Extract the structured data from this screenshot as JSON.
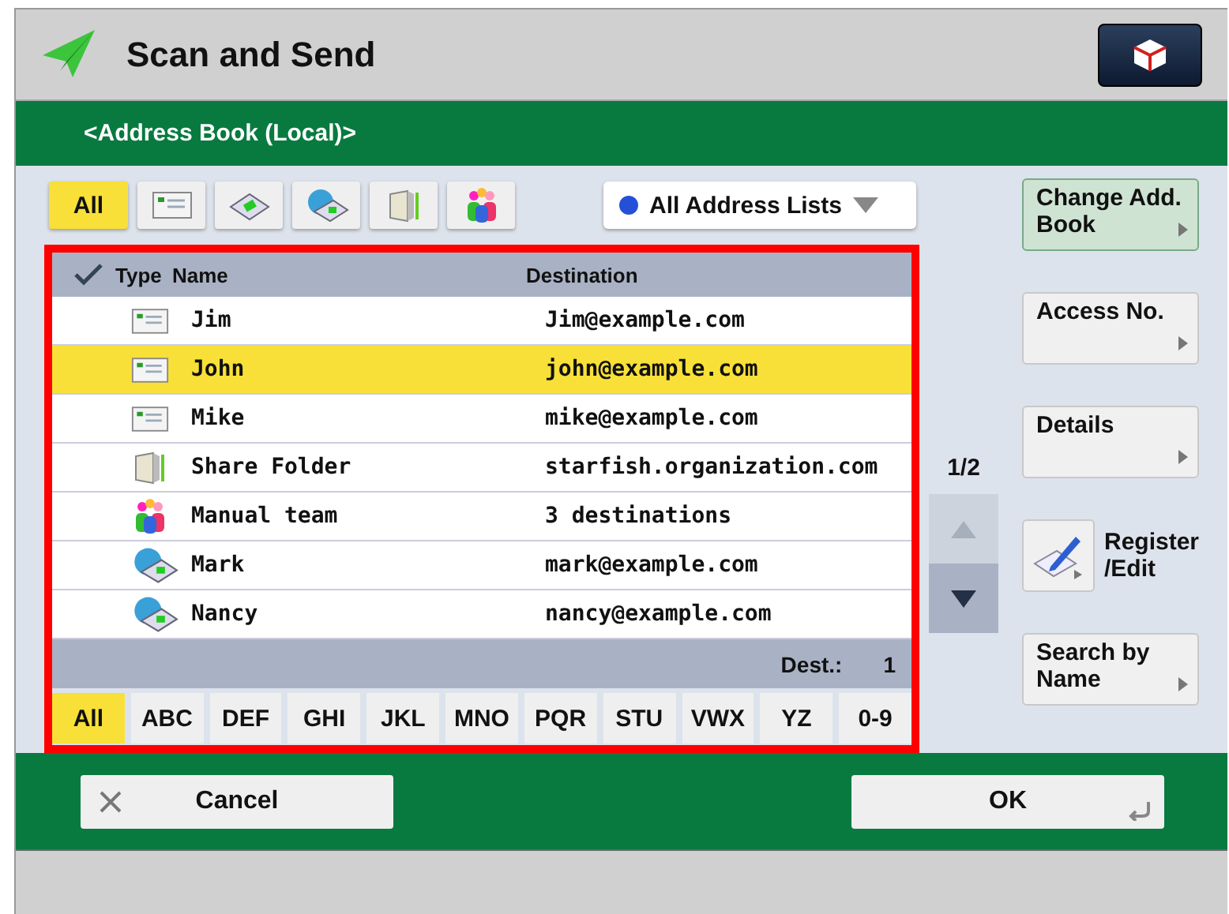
{
  "window": {
    "title": "Scan and Send"
  },
  "subtitle": "<Address Book (Local)>",
  "type_filters": [
    {
      "kind": "all",
      "label": "All",
      "selected": true
    },
    {
      "kind": "email",
      "selected": false
    },
    {
      "kind": "fax",
      "selected": false
    },
    {
      "kind": "ifax",
      "selected": false
    },
    {
      "kind": "folder",
      "selected": false
    },
    {
      "kind": "group",
      "selected": false
    }
  ],
  "address_list_dropdown": "All Address Lists",
  "table": {
    "columns": [
      "Type",
      "Name",
      "Destination"
    ],
    "rows": [
      {
        "kind": "email",
        "name": "Jim",
        "destination": "Jim@example.com",
        "selected": false
      },
      {
        "kind": "email",
        "name": "John",
        "destination": "john@example.com",
        "selected": true
      },
      {
        "kind": "email",
        "name": "Mike",
        "destination": "mike@example.com",
        "selected": false
      },
      {
        "kind": "folder",
        "name": "Share Folder",
        "destination": "starfish.organization.com",
        "selected": false
      },
      {
        "kind": "group",
        "name": "Manual team",
        "destination": "3 destinations",
        "selected": false
      },
      {
        "kind": "ifax",
        "name": "Mark",
        "destination": "mark@example.com",
        "selected": false
      },
      {
        "kind": "ifax",
        "name": "Nancy",
        "destination": "nancy@example.com",
        "selected": false
      }
    ],
    "dest_label": "Dest.:",
    "dest_count": "1"
  },
  "letter_tabs": [
    {
      "label": "All",
      "selected": true
    },
    {
      "label": "ABC",
      "selected": false
    },
    {
      "label": "DEF",
      "selected": false
    },
    {
      "label": "GHI",
      "selected": false
    },
    {
      "label": "JKL",
      "selected": false
    },
    {
      "label": "MNO",
      "selected": false
    },
    {
      "label": "PQR",
      "selected": false
    },
    {
      "label": "STU",
      "selected": false
    },
    {
      "label": "VWX",
      "selected": false
    },
    {
      "label": "YZ",
      "selected": false
    },
    {
      "label": "0-9",
      "selected": false
    }
  ],
  "page_indicator": "1/2",
  "scroll_up": {
    "disabled": true
  },
  "scroll_down": {
    "disabled": false
  },
  "side_buttons": [
    {
      "kind": "text",
      "label": "Change Add. Book",
      "selected": true
    },
    {
      "kind": "text",
      "label": "Access No.",
      "selected": false
    },
    {
      "kind": "text",
      "label": "Details",
      "selected": false
    },
    {
      "kind": "icon",
      "label": "Register /Edit",
      "selected": false
    },
    {
      "kind": "text",
      "label": "Search by Name",
      "selected": false
    }
  ],
  "buttons": {
    "cancel": "Cancel",
    "ok": "OK"
  }
}
